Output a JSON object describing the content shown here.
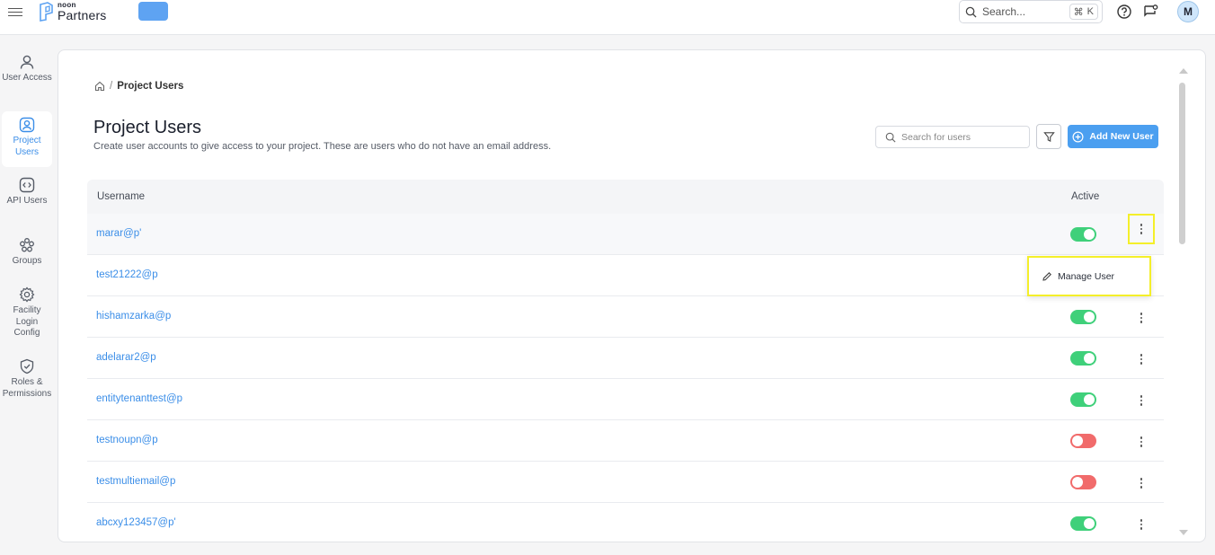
{
  "topbar": {
    "logo_small": "noon",
    "logo_big": "Partners",
    "search_placeholder": "Search...",
    "shortcut_symbol": "⌘",
    "shortcut_key": "K",
    "avatar_initial": "M",
    "icons": [
      "hamburger-icon",
      "search-icon",
      "help-icon",
      "feedback-icon"
    ]
  },
  "sidebar": {
    "items": [
      {
        "label": "User Access",
        "icon": "user-icon",
        "active": false
      },
      {
        "label": "Project Users",
        "icon": "user-circle-icon",
        "active": true
      },
      {
        "label": "API Users",
        "icon": "code-icon",
        "active": false
      },
      {
        "label": "Groups",
        "icon": "groups-icon",
        "active": false
      },
      {
        "label": "Facility Login Config",
        "icon": "gear-icon",
        "active": false
      },
      {
        "label": "Roles & Permissions",
        "icon": "shield-check-icon",
        "active": false
      }
    ]
  },
  "breadcrumb": {
    "current": "Project Users",
    "separator": "/"
  },
  "page": {
    "title": "Project Users",
    "subtitle": "Create user accounts to give access to your project. These are users who do not have an email address.",
    "search_placeholder": "Search for users",
    "add_button_label": "Add New User"
  },
  "table": {
    "columns": {
      "username": "Username",
      "active": "Active"
    },
    "rows": [
      {
        "username": "marar@p'",
        "active": true
      },
      {
        "username": "test21222@p",
        "active": null
      },
      {
        "username": "hishamzarka@p",
        "active": true
      },
      {
        "username": "adelarar2@p",
        "active": true
      },
      {
        "username": "entitytenanttest@p",
        "active": true
      },
      {
        "username": "testnoupn@p",
        "active": false
      },
      {
        "username": "testmultiemail@p",
        "active": false
      },
      {
        "username": "abcxy123457@p'",
        "active": true
      }
    ]
  },
  "context_menu": {
    "item_label": "Manage User",
    "item_icon": "pencil-icon"
  },
  "colors": {
    "accent": "#4b9ff0",
    "toggle_on": "#3fd07a",
    "toggle_off": "#f16b6b",
    "highlight": "#f4ef2a"
  }
}
